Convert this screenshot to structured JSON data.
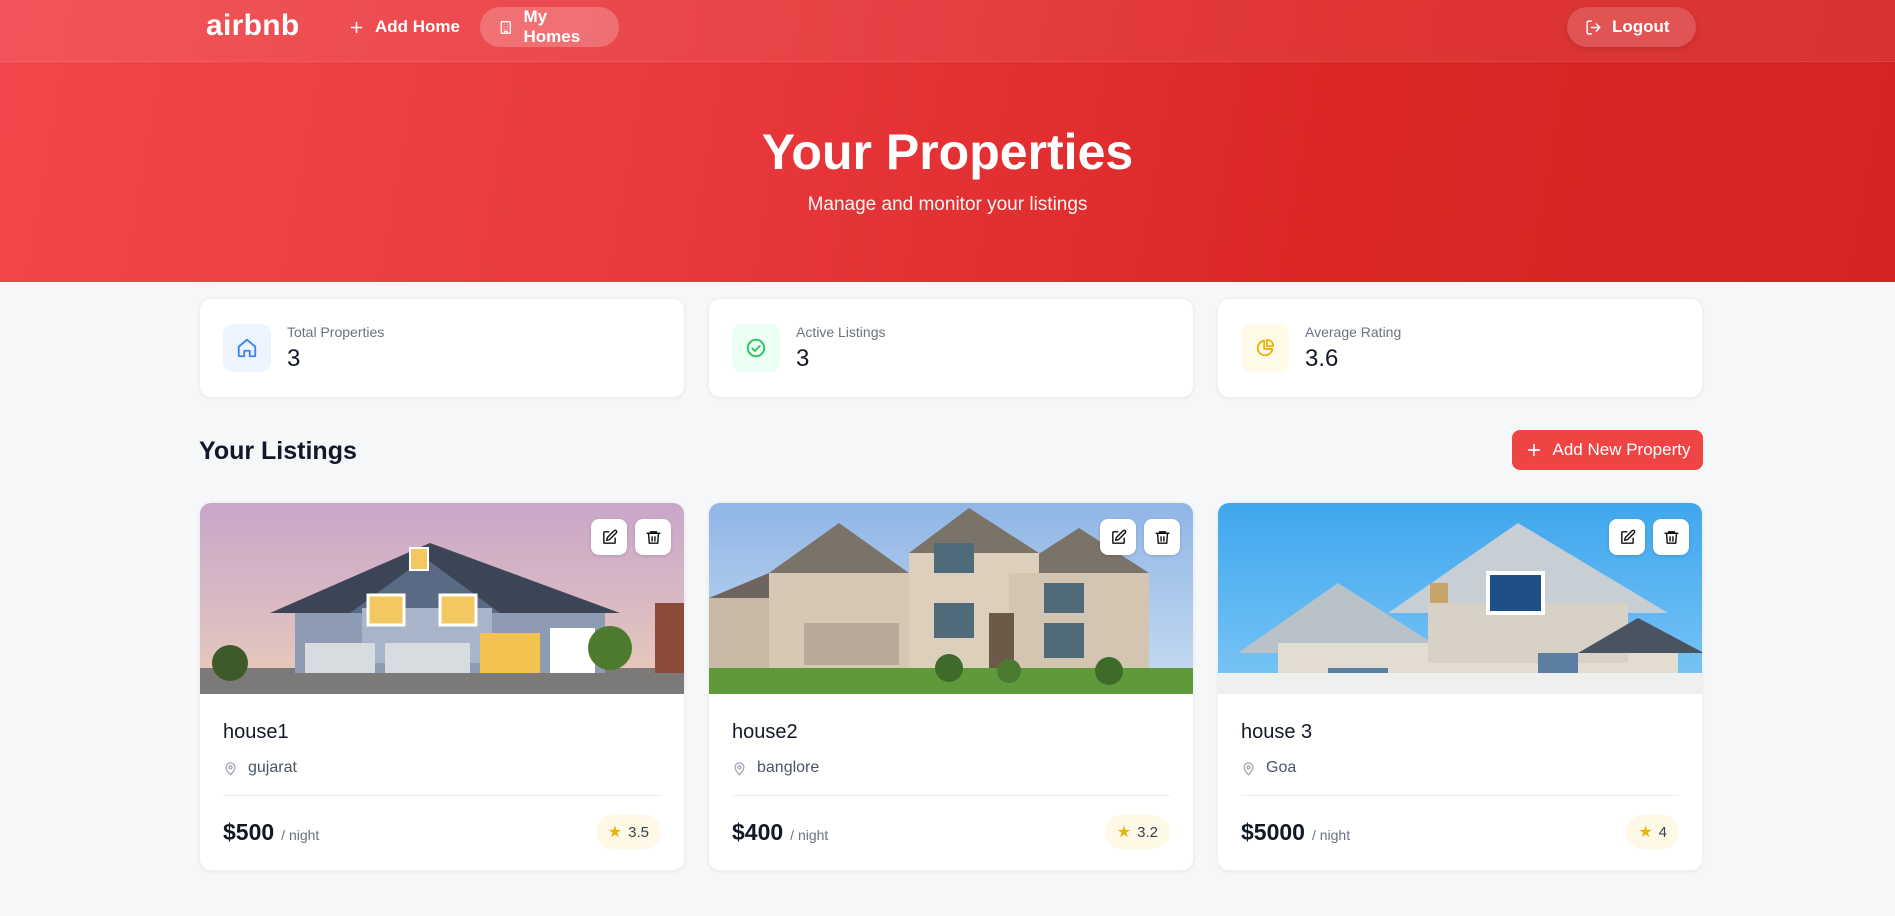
{
  "nav": {
    "logo": "airbnb",
    "add_home": "Add Home",
    "my_homes": "My Homes",
    "logout": "Logout"
  },
  "hero": {
    "title": "Your Properties",
    "subtitle": "Manage and monitor your listings"
  },
  "stats": [
    {
      "label": "Total Properties",
      "value": "3",
      "icon": "home-icon",
      "color": "#3b82f6"
    },
    {
      "label": "Active Listings",
      "value": "3",
      "icon": "check-circle-icon",
      "color": "#22c55e"
    },
    {
      "label": "Average Rating",
      "value": "3.6",
      "icon": "pie-chart-icon",
      "color": "#eab308"
    }
  ],
  "listings_section": {
    "title": "Your Listings",
    "add_button": "Add New Property"
  },
  "listings": [
    {
      "name": "house1",
      "location": "gujarat",
      "price": "$500",
      "unit": "/ night",
      "rating": "3.5"
    },
    {
      "name": "house2",
      "location": "banglore",
      "price": "$400",
      "unit": "/ night",
      "rating": "3.2"
    },
    {
      "name": "house 3",
      "location": "Goa",
      "price": "$5000",
      "unit": "/ night",
      "rating": "4"
    }
  ],
  "colors": {
    "brand": "#ef4444",
    "hero_gradient_start": "#f0484c",
    "hero_gradient_end": "#d62424"
  }
}
